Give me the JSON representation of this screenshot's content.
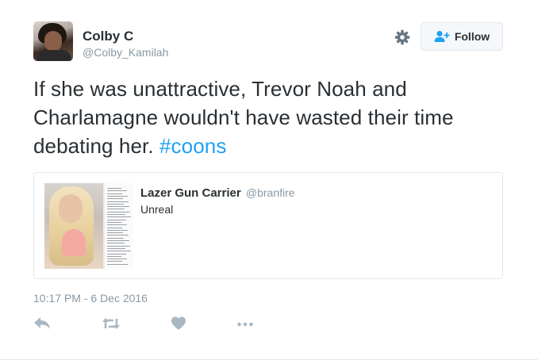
{
  "author": {
    "name": "Colby C",
    "handle": "@Colby_Kamilah",
    "avatar_icon": "profile-photo"
  },
  "header": {
    "settings_icon": "gear-icon",
    "follow_label": "Follow",
    "follow_icon": "add-user-icon"
  },
  "tweet": {
    "text_before_hashtag": "If she was unattractive, Trevor Noah and Charlamagne wouldn't have wasted their time debating her. ",
    "hashtag": "#coons"
  },
  "quote": {
    "name": "Lazer Gun Carrier",
    "handle": "@branfire",
    "text": "Unreal",
    "media_icon": "quoted-media-thumbnail"
  },
  "timestamp": "10:17 PM - 6 Dec 2016",
  "actions": [
    {
      "name": "reply",
      "icon": "reply-icon"
    },
    {
      "name": "retweet",
      "icon": "retweet-icon"
    },
    {
      "name": "like",
      "icon": "heart-icon"
    },
    {
      "name": "more",
      "icon": "more-icon"
    }
  ],
  "colors": {
    "text": "#292f33",
    "muted": "#8899a6",
    "link": "#1da1f2",
    "border": "#e1e8ed",
    "button_bg": "#f5f8fa",
    "icon": "#aab8c2"
  }
}
